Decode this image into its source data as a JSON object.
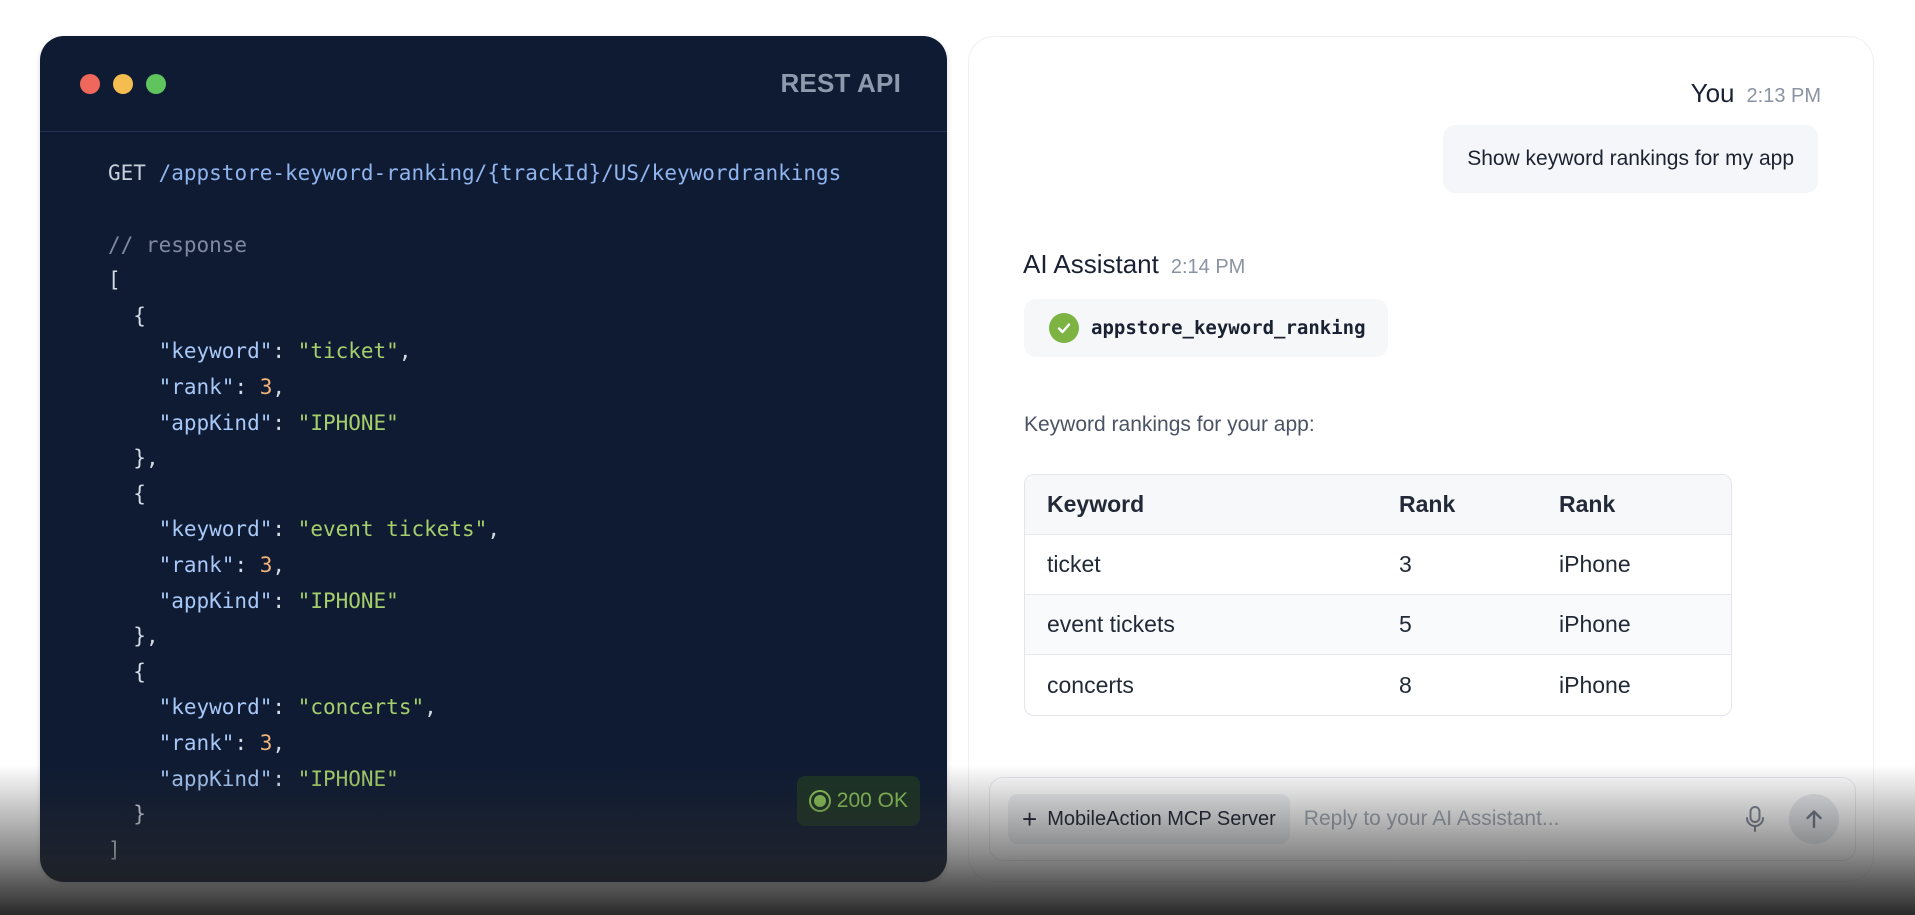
{
  "code_panel": {
    "title": "REST API",
    "window_dots": [
      {
        "name": "close-dot",
        "color": "#f0675c"
      },
      {
        "name": "minimize-dot",
        "color": "#f5bd4f"
      },
      {
        "name": "maximize-dot",
        "color": "#5fc45e"
      }
    ],
    "request": {
      "method": "GET",
      "path": "/appstore-keyword-ranking/{trackId}/US/keywordrankings"
    },
    "comment": "// response",
    "response": [
      {
        "keyword": "ticket",
        "rank": "3",
        "appKind": "IPHONE"
      },
      {
        "keyword": "event tickets",
        "rank": "3",
        "appKind": "IPHONE"
      },
      {
        "keyword": "concerts",
        "rank": "3",
        "appKind": "IPHONE"
      }
    ],
    "status": "200 OK"
  },
  "chat": {
    "user": {
      "name": "You",
      "time": "2:13 PM",
      "message": "Show keyword rankings for my app"
    },
    "assistant": {
      "name": "AI Assistant",
      "time": "2:14 PM",
      "tool_name": "appstore_keyword_ranking",
      "intro": "Keyword rankings for your app:",
      "table": {
        "headers": [
          "Keyword",
          "Rank",
          "Rank"
        ],
        "rows": [
          [
            "ticket",
            "3",
            "iPhone"
          ],
          [
            "event tickets",
            "5",
            "iPhone"
          ],
          [
            "concerts",
            "8",
            "iPhone"
          ]
        ]
      }
    },
    "composer": {
      "server_label": "MobileAction MCP Server",
      "placeholder": "Reply to your AI Assistant..."
    }
  }
}
